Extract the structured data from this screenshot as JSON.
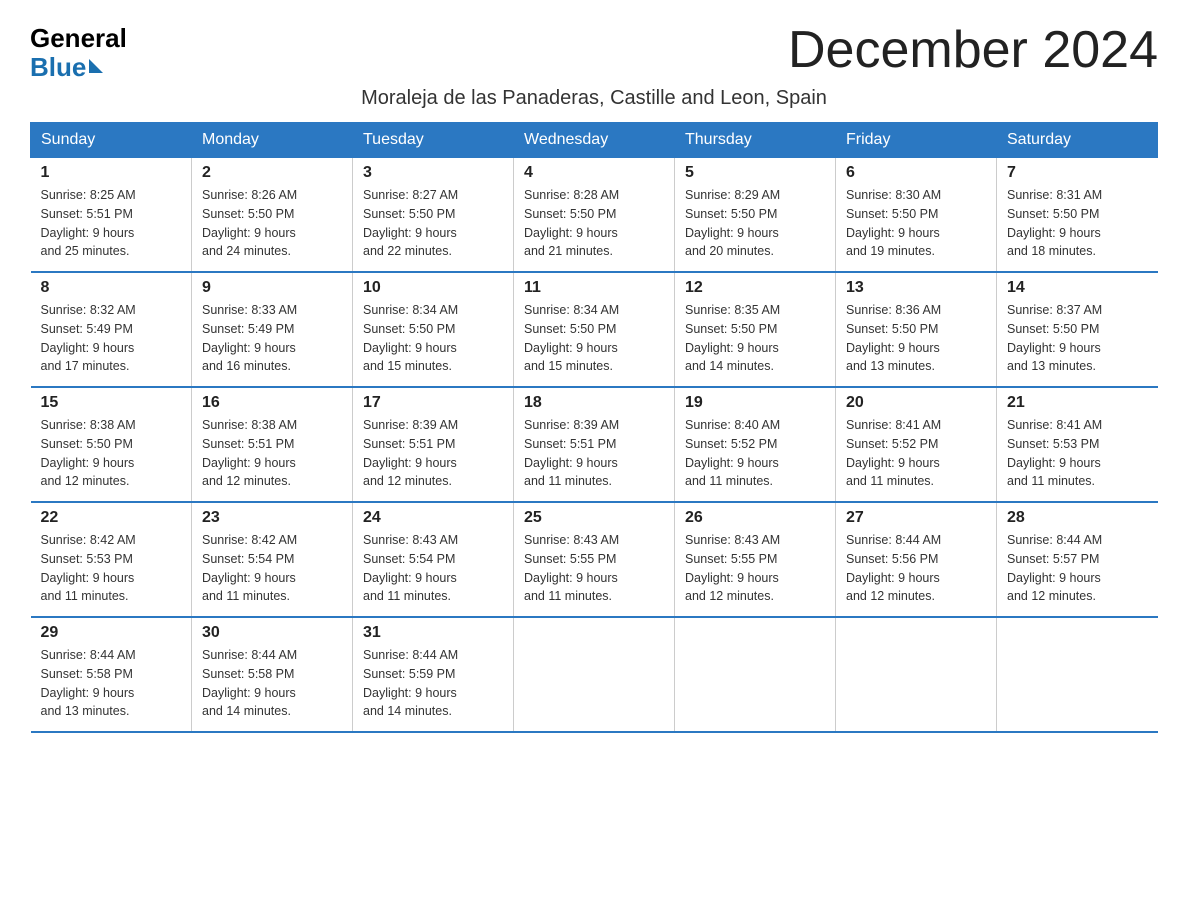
{
  "logo": {
    "general": "General",
    "blue": "Blue"
  },
  "title": "December 2024",
  "location": "Moraleja de las Panaderas, Castille and Leon, Spain",
  "days_of_week": [
    "Sunday",
    "Monday",
    "Tuesday",
    "Wednesday",
    "Thursday",
    "Friday",
    "Saturday"
  ],
  "weeks": [
    [
      {
        "day": "1",
        "sunrise": "8:25 AM",
        "sunset": "5:51 PM",
        "daylight": "9 hours and 25 minutes."
      },
      {
        "day": "2",
        "sunrise": "8:26 AM",
        "sunset": "5:50 PM",
        "daylight": "9 hours and 24 minutes."
      },
      {
        "day": "3",
        "sunrise": "8:27 AM",
        "sunset": "5:50 PM",
        "daylight": "9 hours and 22 minutes."
      },
      {
        "day": "4",
        "sunrise": "8:28 AM",
        "sunset": "5:50 PM",
        "daylight": "9 hours and 21 minutes."
      },
      {
        "day": "5",
        "sunrise": "8:29 AM",
        "sunset": "5:50 PM",
        "daylight": "9 hours and 20 minutes."
      },
      {
        "day": "6",
        "sunrise": "8:30 AM",
        "sunset": "5:50 PM",
        "daylight": "9 hours and 19 minutes."
      },
      {
        "day": "7",
        "sunrise": "8:31 AM",
        "sunset": "5:50 PM",
        "daylight": "9 hours and 18 minutes."
      }
    ],
    [
      {
        "day": "8",
        "sunrise": "8:32 AM",
        "sunset": "5:49 PM",
        "daylight": "9 hours and 17 minutes."
      },
      {
        "day": "9",
        "sunrise": "8:33 AM",
        "sunset": "5:49 PM",
        "daylight": "9 hours and 16 minutes."
      },
      {
        "day": "10",
        "sunrise": "8:34 AM",
        "sunset": "5:50 PM",
        "daylight": "9 hours and 15 minutes."
      },
      {
        "day": "11",
        "sunrise": "8:34 AM",
        "sunset": "5:50 PM",
        "daylight": "9 hours and 15 minutes."
      },
      {
        "day": "12",
        "sunrise": "8:35 AM",
        "sunset": "5:50 PM",
        "daylight": "9 hours and 14 minutes."
      },
      {
        "day": "13",
        "sunrise": "8:36 AM",
        "sunset": "5:50 PM",
        "daylight": "9 hours and 13 minutes."
      },
      {
        "day": "14",
        "sunrise": "8:37 AM",
        "sunset": "5:50 PM",
        "daylight": "9 hours and 13 minutes."
      }
    ],
    [
      {
        "day": "15",
        "sunrise": "8:38 AM",
        "sunset": "5:50 PM",
        "daylight": "9 hours and 12 minutes."
      },
      {
        "day": "16",
        "sunrise": "8:38 AM",
        "sunset": "5:51 PM",
        "daylight": "9 hours and 12 minutes."
      },
      {
        "day": "17",
        "sunrise": "8:39 AM",
        "sunset": "5:51 PM",
        "daylight": "9 hours and 12 minutes."
      },
      {
        "day": "18",
        "sunrise": "8:39 AM",
        "sunset": "5:51 PM",
        "daylight": "9 hours and 11 minutes."
      },
      {
        "day": "19",
        "sunrise": "8:40 AM",
        "sunset": "5:52 PM",
        "daylight": "9 hours and 11 minutes."
      },
      {
        "day": "20",
        "sunrise": "8:41 AM",
        "sunset": "5:52 PM",
        "daylight": "9 hours and 11 minutes."
      },
      {
        "day": "21",
        "sunrise": "8:41 AM",
        "sunset": "5:53 PM",
        "daylight": "9 hours and 11 minutes."
      }
    ],
    [
      {
        "day": "22",
        "sunrise": "8:42 AM",
        "sunset": "5:53 PM",
        "daylight": "9 hours and 11 minutes."
      },
      {
        "day": "23",
        "sunrise": "8:42 AM",
        "sunset": "5:54 PM",
        "daylight": "9 hours and 11 minutes."
      },
      {
        "day": "24",
        "sunrise": "8:43 AM",
        "sunset": "5:54 PM",
        "daylight": "9 hours and 11 minutes."
      },
      {
        "day": "25",
        "sunrise": "8:43 AM",
        "sunset": "5:55 PM",
        "daylight": "9 hours and 11 minutes."
      },
      {
        "day": "26",
        "sunrise": "8:43 AM",
        "sunset": "5:55 PM",
        "daylight": "9 hours and 12 minutes."
      },
      {
        "day": "27",
        "sunrise": "8:44 AM",
        "sunset": "5:56 PM",
        "daylight": "9 hours and 12 minutes."
      },
      {
        "day": "28",
        "sunrise": "8:44 AM",
        "sunset": "5:57 PM",
        "daylight": "9 hours and 12 minutes."
      }
    ],
    [
      {
        "day": "29",
        "sunrise": "8:44 AM",
        "sunset": "5:58 PM",
        "daylight": "9 hours and 13 minutes."
      },
      {
        "day": "30",
        "sunrise": "8:44 AM",
        "sunset": "5:58 PM",
        "daylight": "9 hours and 14 minutes."
      },
      {
        "day": "31",
        "sunrise": "8:44 AM",
        "sunset": "5:59 PM",
        "daylight": "9 hours and 14 minutes."
      },
      null,
      null,
      null,
      null
    ]
  ],
  "labels": {
    "sunrise": "Sunrise:",
    "sunset": "Sunset:",
    "daylight": "Daylight:"
  }
}
